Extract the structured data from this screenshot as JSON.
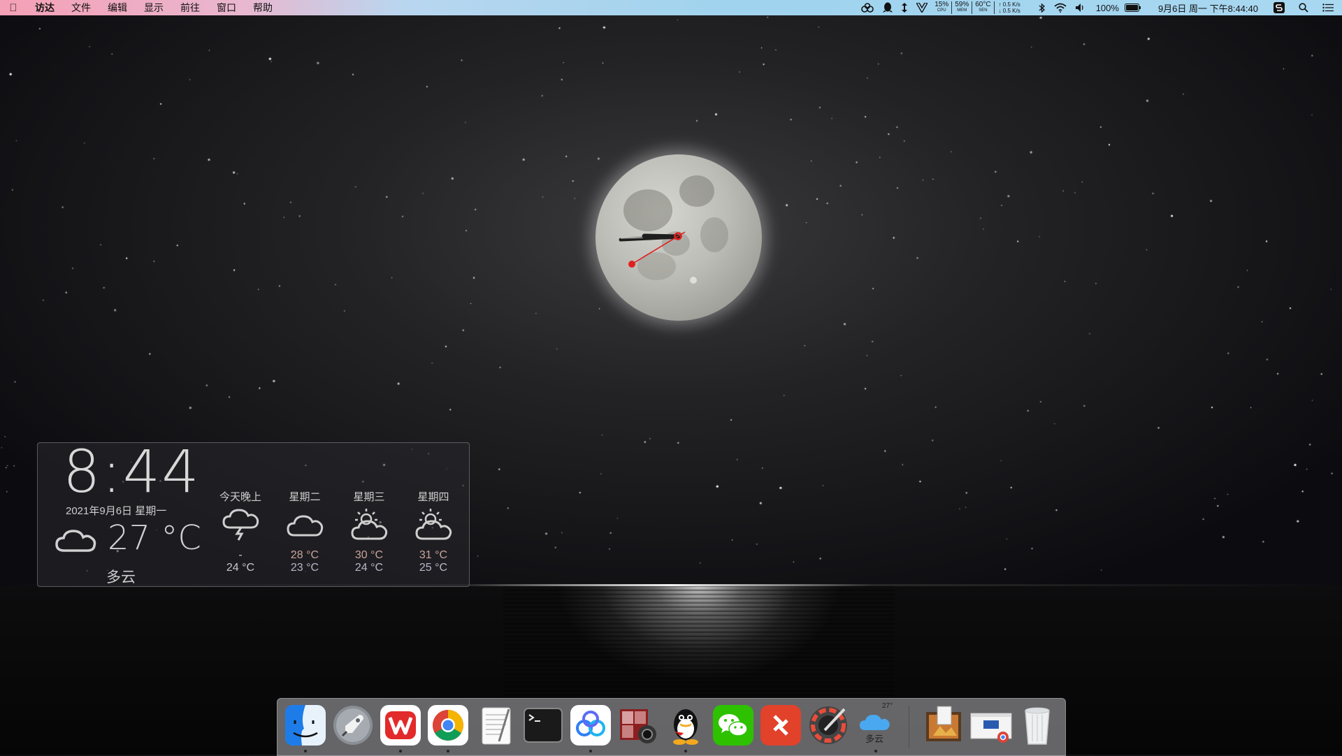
{
  "menubar": {
    "apple_label": "",
    "items": [
      "访达",
      "文件",
      "编辑",
      "显示",
      "前往",
      "窗口",
      "帮助"
    ],
    "stats": {
      "cpu": {
        "value": "15%",
        "label": "CPU"
      },
      "mem": {
        "value": "59%",
        "label": "MEM"
      },
      "sen": {
        "value": "60°C",
        "label": "SEN"
      },
      "net_up": "↑ 0.5 K/s",
      "net_down": "↓ 0.5 K/s"
    },
    "battery": "100%",
    "datetime": "9月6日 周一 下午8:44:40"
  },
  "widget": {
    "time": "8:44",
    "date": "2021年9月6日 星期一",
    "temp": "27 °C",
    "condition": "多云",
    "forecast": [
      {
        "day": "今天晚上",
        "icon": "thunder-cloud-icon",
        "high": "-",
        "low": "24 °C"
      },
      {
        "day": "星期二",
        "icon": "cloud-icon",
        "high": "28 °C",
        "low": "23 °C"
      },
      {
        "day": "星期三",
        "icon": "partly-sunny-icon",
        "high": "30 °C",
        "low": "24 °C"
      },
      {
        "day": "星期四",
        "icon": "partly-sunny-icon",
        "high": "31 °C",
        "low": "25 °C"
      }
    ]
  },
  "dock": {
    "apps": [
      {
        "name": "finder-icon",
        "running": true
      },
      {
        "name": "launchpad-icon",
        "running": false
      },
      {
        "name": "wps-icon",
        "running": true
      },
      {
        "name": "chrome-icon",
        "running": true
      },
      {
        "name": "textedit-icon",
        "running": false
      },
      {
        "name": "terminal-icon",
        "running": false
      },
      {
        "name": "baidu-netdisk-icon",
        "running": true
      },
      {
        "name": "photo-booth-icon",
        "running": false
      },
      {
        "name": "qq-icon",
        "running": true
      },
      {
        "name": "wechat-icon",
        "running": false
      },
      {
        "name": "remote-desktop-icon",
        "running": false
      },
      {
        "name": "digital-color-meter-icon",
        "running": false
      },
      {
        "name": "weather-icon",
        "running": true
      }
    ],
    "weather_temp": "27°",
    "weather_text": "多云"
  },
  "colors": {
    "clock_second_hand": "#e0201e",
    "clock_hands": "#1e1e1e"
  }
}
